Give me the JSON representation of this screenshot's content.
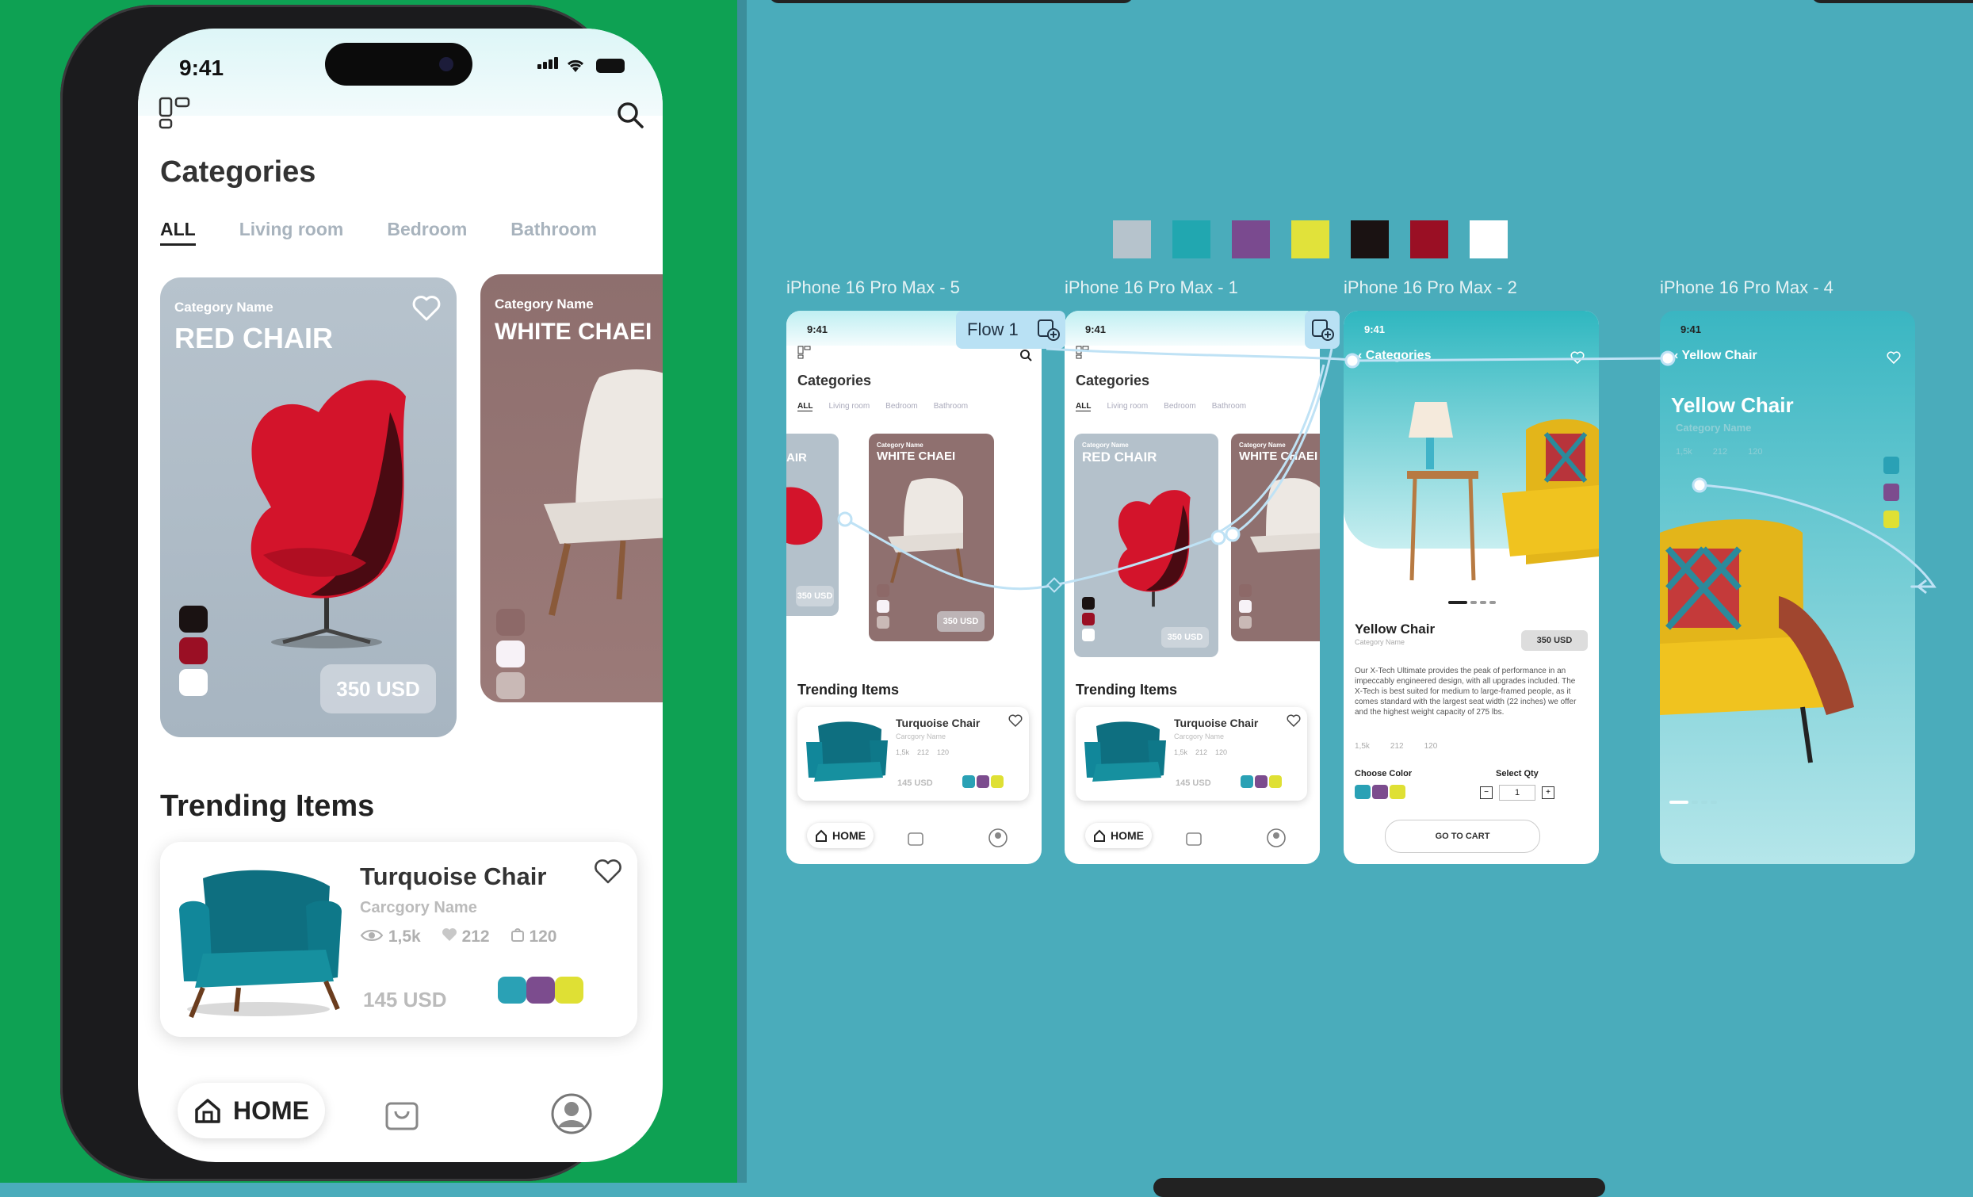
{
  "phone": {
    "status_time": "9:41",
    "title": "Categories",
    "tabs": [
      "ALL",
      "Living room",
      "Bedroom",
      "Bathroom"
    ],
    "featured": [
      {
        "category": "Category Name",
        "name": "RED CHAIR",
        "price": "350 USD",
        "colors": [
          "#1a1212",
          "#9a0f24",
          "#ffffff"
        ]
      },
      {
        "category": "Category Name",
        "name": "WHITE CHAEI",
        "colors": [
          "#8d6968",
          "#f7f2f7",
          "#c9b9b6"
        ]
      }
    ],
    "trending_title": "Trending Items",
    "trending": {
      "name": "Turquoise Chair",
      "category": "Carcgory Name",
      "views": "1,5k",
      "likes": "212",
      "carts": "120",
      "price": "145 USD",
      "colors": [
        "#2aa1b5",
        "#7c4c8e",
        "#dfe034"
      ]
    },
    "nav": {
      "home_label": "HOME"
    }
  },
  "canvas": {
    "palette": [
      "#b6c3cc",
      "#21a7b0",
      "#7a4a8f",
      "#e1e23a",
      "#1a1212",
      "#9a0f24",
      "#ffffff"
    ],
    "flow_label": "Flow 1",
    "frames": [
      {
        "label": "iPhone 16 Pro Max - 5"
      },
      {
        "label": "iPhone 16 Pro Max - 1"
      },
      {
        "label": "iPhone 16 Pro Max - 2"
      },
      {
        "label": "iPhone 16 Pro Max - 4"
      }
    ],
    "frame5": {
      "time": "9:41",
      "title": "Categories",
      "tabs": [
        "ALL",
        "Living room",
        "Bedroom",
        "Bathroom"
      ],
      "card_a_name": "AIR",
      "card_a_price": "350 USD",
      "card_b_cat": "Category Name",
      "card_b_name": "WHITE CHAEI",
      "card_b_price": "350 USD",
      "trending_title": "Trending Items",
      "item_name": "Turquoise Chair",
      "item_cat": "Carcgory Name",
      "item_views": "1,5k",
      "item_likes": "212",
      "item_carts": "120",
      "item_price": "145 USD",
      "home": "HOME"
    },
    "frame1": {
      "time": "9:41",
      "title": "Categories",
      "tabs": [
        "ALL",
        "Living room",
        "Bedroom",
        "Bathroom"
      ],
      "card_a_cat": "Category Name",
      "card_a_name": "RED CHAIR",
      "card_a_price": "350 USD",
      "card_b_cat": "Category Name",
      "card_b_name": "WHITE CHAEI",
      "trending_title": "Trending Items",
      "item_name": "Turquoise Chair",
      "item_cat": "Carcgory Name",
      "item_views": "1,5k",
      "item_likes": "212",
      "item_carts": "120",
      "item_price": "145 USD",
      "home": "HOME"
    },
    "frame2": {
      "time": "9:41",
      "back_label": "Categories",
      "name": "Yellow Chair",
      "category": "Category Name",
      "price": "350 USD",
      "description": "Our X-Tech Ultimate provides the peak of performance in an impeccably engineered design, with all upgrades included. The X-Tech is best suited for medium to large-framed people, as it comes standard with the largest seat width (22 inches) we offer and the highest weight capacity of 275 lbs.",
      "views": "1,5k",
      "likes": "212",
      "carts": "120",
      "choose_color": "Choose Color",
      "select_qty": "Select Qty",
      "qty": "1",
      "cta": "GO TO CART"
    },
    "frame4": {
      "time": "9:41",
      "back_label": "Yellow Chair",
      "name": "Yellow Chair",
      "category": "Category Name",
      "views": "1,5k",
      "likes": "212",
      "carts": "120"
    }
  }
}
